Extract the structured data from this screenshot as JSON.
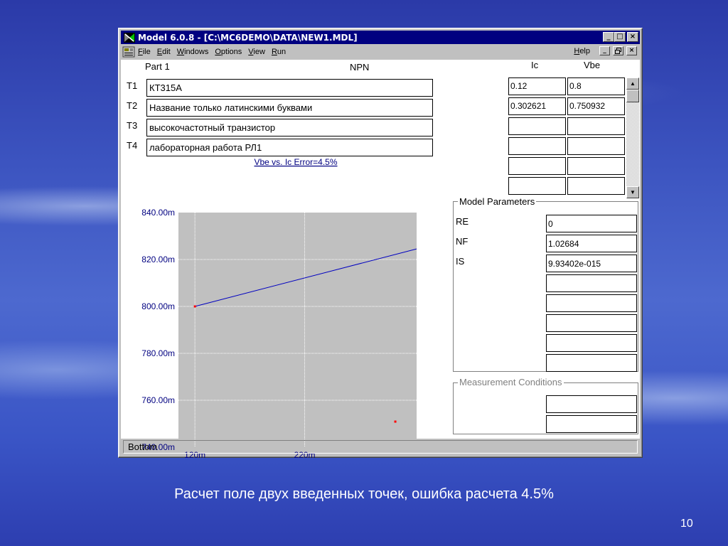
{
  "window": {
    "title": "Model 6.0.8 - [C:\\MC6DEMO\\DATA\\NEW1.MDL]",
    "title_buttons": [
      "_",
      "□",
      "×"
    ],
    "menu": [
      "File",
      "Edit",
      "Windows",
      "Options",
      "View",
      "Run"
    ],
    "help": "Help",
    "mdi_buttons": [
      "_",
      "̸",
      "×"
    ]
  },
  "part": {
    "label": "Part 1",
    "type": "NPN"
  },
  "text_fields": [
    {
      "label": "T1",
      "value": "КТ315А"
    },
    {
      "label": "T2",
      "value": "Название только латинскими буквами"
    },
    {
      "label": "T3",
      "value": "высокочастотный транзистор"
    },
    {
      "label": "T4",
      "value": "лабораторная работа РЛ1"
    }
  ],
  "data_table": {
    "headers": [
      "Ic",
      "Vbe"
    ],
    "rows": [
      [
        "0.12",
        "0.8"
      ],
      [
        "0.302621",
        "0.750932"
      ],
      [
        "",
        ""
      ],
      [
        "",
        ""
      ],
      [
        "",
        ""
      ],
      [
        "",
        ""
      ]
    ]
  },
  "chart_data": {
    "type": "line",
    "title": "Vbe vs. Ic Error=4.5%",
    "xlim": [
      0.105,
      0.322
    ],
    "ylim": [
      0.74,
      0.84
    ],
    "y_ticks": [
      "840.00m",
      "820.00m",
      "800.00m",
      "780.00m",
      "760.00m",
      "740.00m"
    ],
    "y_tick_values": [
      0.84,
      0.82,
      0.8,
      0.78,
      0.76,
      0.74
    ],
    "x_ticks": [
      "120m",
      "220m"
    ],
    "x_tick_values": [
      0.12,
      0.22
    ],
    "series": [
      {
        "x": [
          0.12,
          0.322
        ],
        "y": [
          0.8,
          0.8245
        ]
      }
    ],
    "points": [
      {
        "x": 0.12,
        "y": 0.8
      },
      {
        "x": 0.3026,
        "y": 0.7509
      }
    ],
    "grid": true,
    "colors": {
      "plot_bg": "#c0c0c0",
      "line": "#0000c0",
      "points": "#ff0000",
      "grid": "#ffffff"
    }
  },
  "model_params": {
    "title": "Model Parameters",
    "rows": [
      {
        "label": "RE",
        "value": "0"
      },
      {
        "label": "NF",
        "value": "1.02684"
      },
      {
        "label": "IS",
        "value": "9.93402e-015"
      },
      {
        "label": "",
        "value": ""
      },
      {
        "label": "",
        "value": ""
      },
      {
        "label": "",
        "value": ""
      },
      {
        "label": "",
        "value": ""
      },
      {
        "label": "",
        "value": ""
      }
    ]
  },
  "measurement": {
    "title": "Measurement Conditions",
    "fields": [
      "",
      ""
    ]
  },
  "status": "Bottom",
  "caption": "Расчет поле двух введенных точек, ошибка расчета 4.5%",
  "page_number": "10"
}
